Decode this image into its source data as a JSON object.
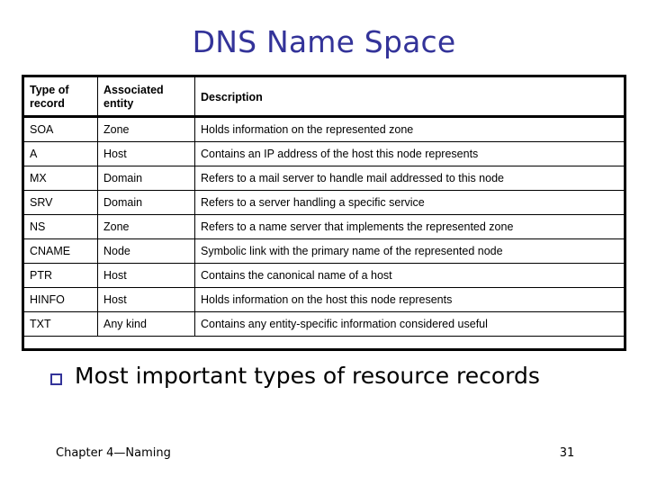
{
  "slide": {
    "title": "DNS Name Space",
    "title_color": "#333399",
    "background_color": "#ffffff"
  },
  "table": {
    "headers": {
      "type_of_record": "Type of record",
      "associated_entity": "Associated entity",
      "description": "Description"
    },
    "rows": [
      {
        "type": "SOA",
        "entity": "Zone",
        "description": "Holds information on the represented zone"
      },
      {
        "type": "A",
        "entity": "Host",
        "description": "Contains an IP address of the host this node represents"
      },
      {
        "type": "MX",
        "entity": "Domain",
        "description": "Refers to a mail server to handle mail addressed to this node"
      },
      {
        "type": "SRV",
        "entity": "Domain",
        "description": "Refers to a server handling a specific service"
      },
      {
        "type": "NS",
        "entity": "Zone",
        "description": "Refers to a name server that implements the represented zone"
      },
      {
        "type": "CNAME",
        "entity": "Node",
        "description": "Symbolic link with the primary name of the represented node"
      },
      {
        "type": "PTR",
        "entity": "Host",
        "description": "Contains the canonical name of a host"
      },
      {
        "type": "HINFO",
        "entity": "Host",
        "description": "Holds information on the host this node represents"
      },
      {
        "type": "TXT",
        "entity": "Any kind",
        "description": "Contains any entity-specific information considered useful"
      }
    ]
  },
  "bullet": {
    "marker_icon": "hollow-square-bullet-icon",
    "marker_color": "#333399",
    "text": "Most important types of resource records"
  },
  "footer": {
    "left": "Chapter 4—Naming",
    "page_number": "31"
  }
}
